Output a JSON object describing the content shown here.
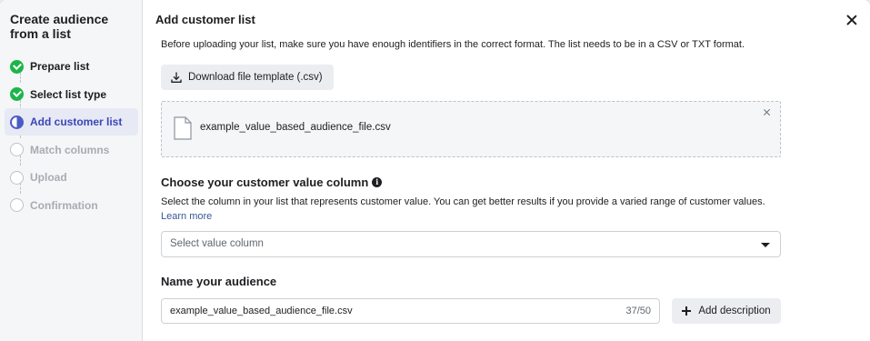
{
  "sidebar": {
    "title": "Create audience from a list",
    "steps": [
      {
        "label": "Prepare list",
        "state": "done"
      },
      {
        "label": "Select list type",
        "state": "done"
      },
      {
        "label": "Add customer list",
        "state": "current"
      },
      {
        "label": "Match columns",
        "state": "pending"
      },
      {
        "label": "Upload",
        "state": "pending"
      },
      {
        "label": "Confirmation",
        "state": "pending"
      }
    ]
  },
  "main": {
    "title": "Add customer list",
    "intro": "Before uploading your list, make sure you have enough identifiers in the correct format. The list needs to be in a CSV or TXT format.",
    "download_label": "Download file template (.csv)",
    "file_name": "example_value_based_audience_file.csv",
    "value_column": {
      "title": "Choose your customer value column",
      "info_glyph": "i",
      "description": "Select the column in your list that represents customer value. You can get better results if you provide a varied range of customer values.",
      "learn_more": "Learn more",
      "select_placeholder": "Select value column"
    },
    "name": {
      "title": "Name your audience",
      "value": "example_value_based_audience_file.csv",
      "counter": "37/50",
      "add_description_label": "Add description"
    }
  },
  "colors": {
    "done": "#1cb54a",
    "active_accent": "#4b5cc4",
    "link": "#385898"
  }
}
